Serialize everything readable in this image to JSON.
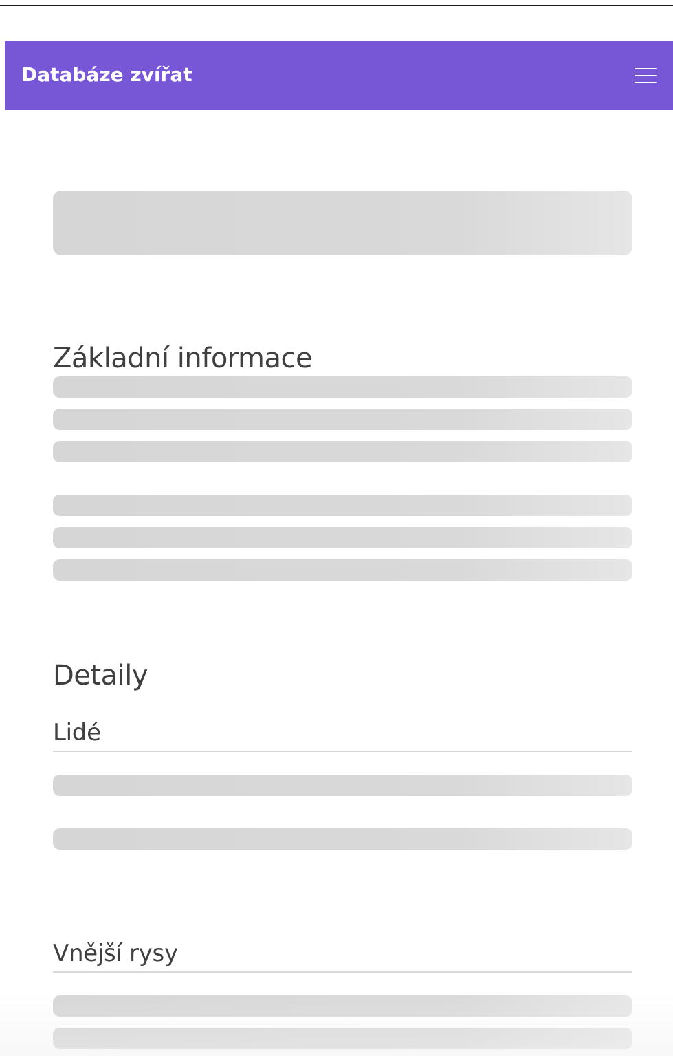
{
  "navbar": {
    "brand": "Databáze zvířat",
    "menu_icon": "hamburger-menu-icon",
    "background_color": "#7857d6"
  },
  "main": {
    "basic_info_heading": "Základní informace",
    "details_heading": "Detaily",
    "people_heading": "Lidé",
    "appearance_heading": "Vnější rysy"
  },
  "skeleton_color": "#d9d9d9"
}
